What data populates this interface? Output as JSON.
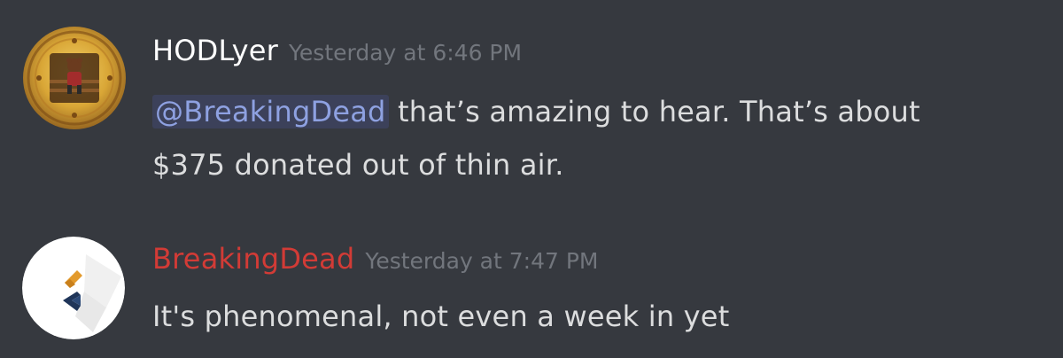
{
  "messages": [
    {
      "author": "HODLyer",
      "timestamp": "Yesterday at 6:46 PM",
      "mention": "@BreakingDead",
      "text_line1": " that’s amazing to hear. That’s about",
      "text_line2": "$375 donated out of thin air.",
      "avatar_icon": "bear-album-cover-avatar"
    },
    {
      "author": "BreakingDead",
      "author_color": "#d23b36",
      "timestamp": "Yesterday at 7:47 PM",
      "text": "It's phenomenal, not even a week in yet",
      "avatar_icon": "chevron-logo-avatar"
    }
  ],
  "colors": {
    "background": "#36393f",
    "username": "#ffffff",
    "timestamp": "#72767d",
    "message_text": "#dcddde",
    "mention_text": "#8ea1e1",
    "mention_bg": "#3c415a"
  }
}
